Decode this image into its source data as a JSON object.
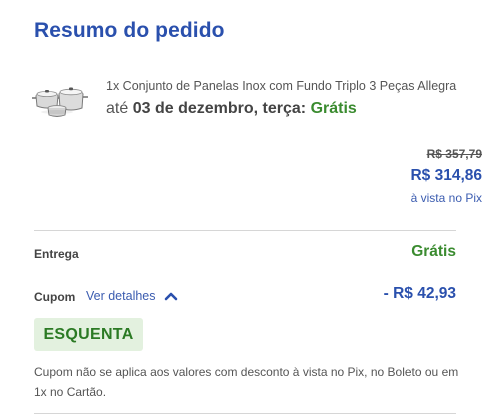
{
  "summary": {
    "title": "Resumo do pedido"
  },
  "product": {
    "name": "1x Conjunto de Panelas Inox com Fundo Triplo 3 Peças Allegra",
    "image_icon": "cookware-set-icon",
    "delivery_prefix": "até",
    "delivery_date": "03 de dezembro, terça:",
    "delivery_cost": "Grátis"
  },
  "pricing": {
    "old_price": "R$ 357,79",
    "new_price": "R$ 314,86",
    "pix_note": "à vista no Pix"
  },
  "shipping": {
    "label": "Entrega",
    "value": "Grátis"
  },
  "coupon": {
    "label": "Cupom",
    "details_link": "Ver detalhes",
    "details_icon": "chevron-up-icon",
    "discount": "- R$ 42,93",
    "code": "ESQUENTA",
    "disclaimer": "Cupom não se aplica aos valores com desconto à vista no Pix, no Boleto ou em 1x no Cartão."
  },
  "colors": {
    "brand_blue": "#2a50ad",
    "success_green": "#3a8b2f",
    "coupon_badge_bg": "#e3f1df"
  }
}
